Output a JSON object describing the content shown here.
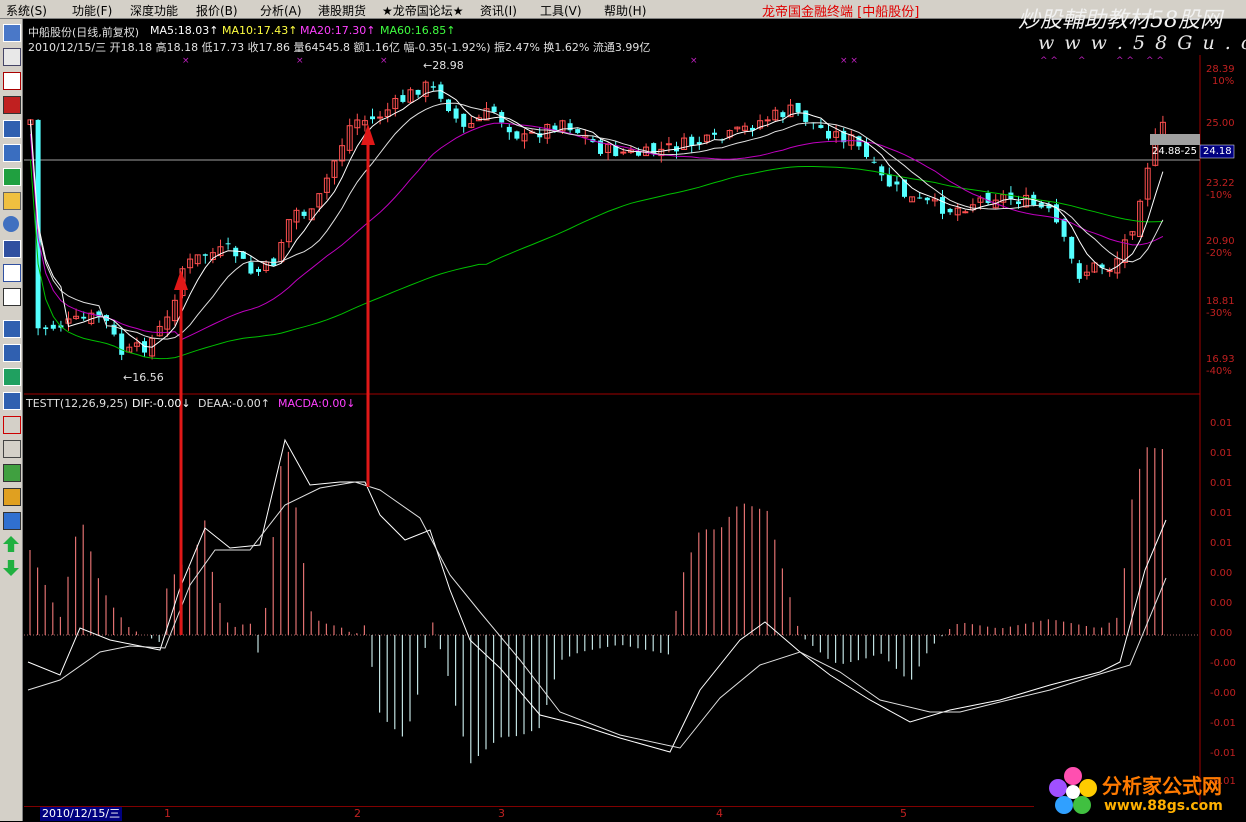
{
  "menu": {
    "items": [
      "系统(S)",
      "功能(F)",
      "深度功能",
      "报价(B)",
      "分析(A)",
      "港股期货",
      "★龙帝国论坛★",
      "资讯(I)",
      "工具(V)",
      "帮助(H)"
    ],
    "app_title": "龙帝国金融终端 [中船股份]"
  },
  "watermark": {
    "main": "炒股輔助教材58股网",
    "url": "w w w . 5 8 G u . c o m"
  },
  "main_panel": {
    "title": "中船股份(日线,前复权)",
    "ma5": "MA5:18.03↑",
    "ma10": "MA10:17.43↑",
    "ma20": "MA20:17.30↑",
    "ma60": "MA60:16.85↑",
    "info_line": "2010/12/15/三 开18.18 高18.18 低17.73 收17.86 量64545.8 额1.16亿 幅-0.35(-1.92%) 振2.47% 换1.62% 流通3.99亿",
    "high_marker": "←28.98",
    "low_marker": "←16.56",
    "current_price": "24.18",
    "price_box": "24.88-25"
  },
  "sub_panel": {
    "title": "TESTT(12,26,9,25)",
    "dif": "DIF:-0.00↓",
    "deaa": "DEAA:-0.00↑",
    "macda": "MACDA:0.00↓"
  },
  "price_axis": [
    {
      "price": "28.39",
      "pct": "10%"
    },
    {
      "price": "25.00",
      "pct": ""
    },
    {
      "price": "23.22",
      "pct": "-10%"
    },
    {
      "price": "20.90",
      "pct": "-20%"
    },
    {
      "price": "18.81",
      "pct": "-30%"
    },
    {
      "price": "16.93",
      "pct": "-40%"
    }
  ],
  "macd_axis": [
    "0.01",
    "0.01",
    "0.01",
    "0.01",
    "0.01",
    "0.00",
    "0.00",
    "0.00",
    "-0.00",
    "-0.00",
    "-0.01",
    "-0.01",
    "-0.01"
  ],
  "bottom": {
    "date": "2010/12/15/三",
    "months": [
      "1",
      "2",
      "3",
      "4",
      "5"
    ]
  },
  "logo": {
    "text": "分析家公式网",
    "url": "www.88gs.com"
  },
  "colors": {
    "up": "#ff5050",
    "down": "#54ffff",
    "ma5": "#ffffff",
    "ma10": "#ffff00",
    "ma20": "#ff00ff",
    "ma60": "#00ff00",
    "grid": "#800000",
    "axis_text": "#c02020"
  }
}
